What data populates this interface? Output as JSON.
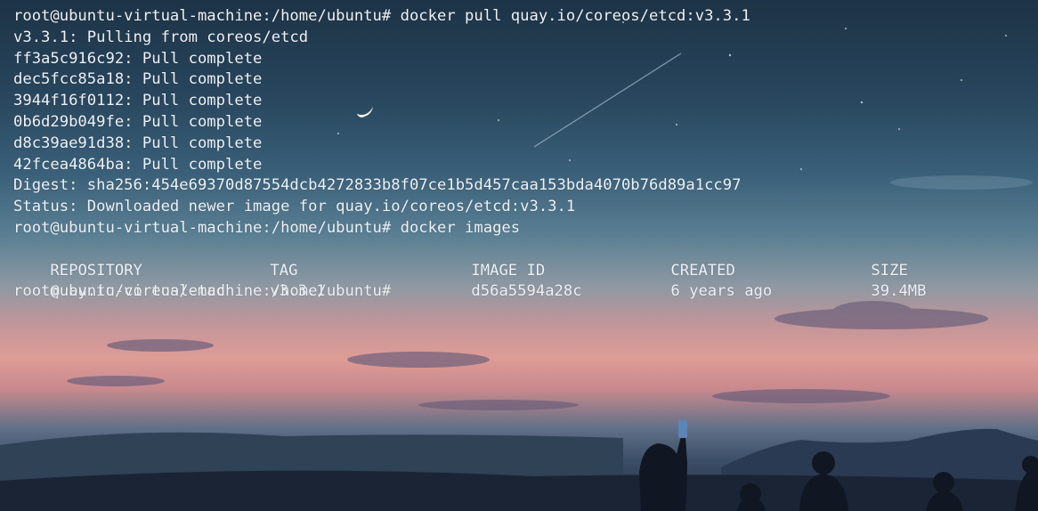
{
  "terminal": {
    "lines": [
      "root@ubuntu-virtual-machine:/home/ubuntu# docker pull quay.io/coreos/etcd:v3.3.1",
      "v3.3.1: Pulling from coreos/etcd",
      "ff3a5c916c92: Pull complete",
      "dec5fcc85a18: Pull complete",
      "3944f16f0112: Pull complete",
      "0b6d29b049fe: Pull complete",
      "d8c39ae91d38: Pull complete",
      "42fcea4864ba: Pull complete",
      "Digest: sha256:454e69370d87554dcb4272833b8f07ce1b5d457caa153bda4070b76d89a1cc97",
      "Status: Downloaded newer image for quay.io/coreos/etcd:v3.3.1",
      "root@ubuntu-virtual-machine:/home/ubuntu# docker images"
    ],
    "table": {
      "headers": {
        "repository": "REPOSITORY",
        "tag": "TAG",
        "image_id": "IMAGE ID",
        "created": "CREATED",
        "size": "SIZE"
      },
      "rows": [
        {
          "repository": "quay.io/coreos/etcd",
          "tag": "v3.3.1",
          "image_id": "d56a5594a28c",
          "created": "6 years ago",
          "size": "39.4MB"
        }
      ]
    },
    "prompt": "root@ubuntu-virtual-machine:/home/ubuntu#"
  },
  "colors": {
    "text": "#eef2f6",
    "sky_top": "#1d3346",
    "sunset": "#de9c96",
    "ground": "#1f2a3b"
  }
}
